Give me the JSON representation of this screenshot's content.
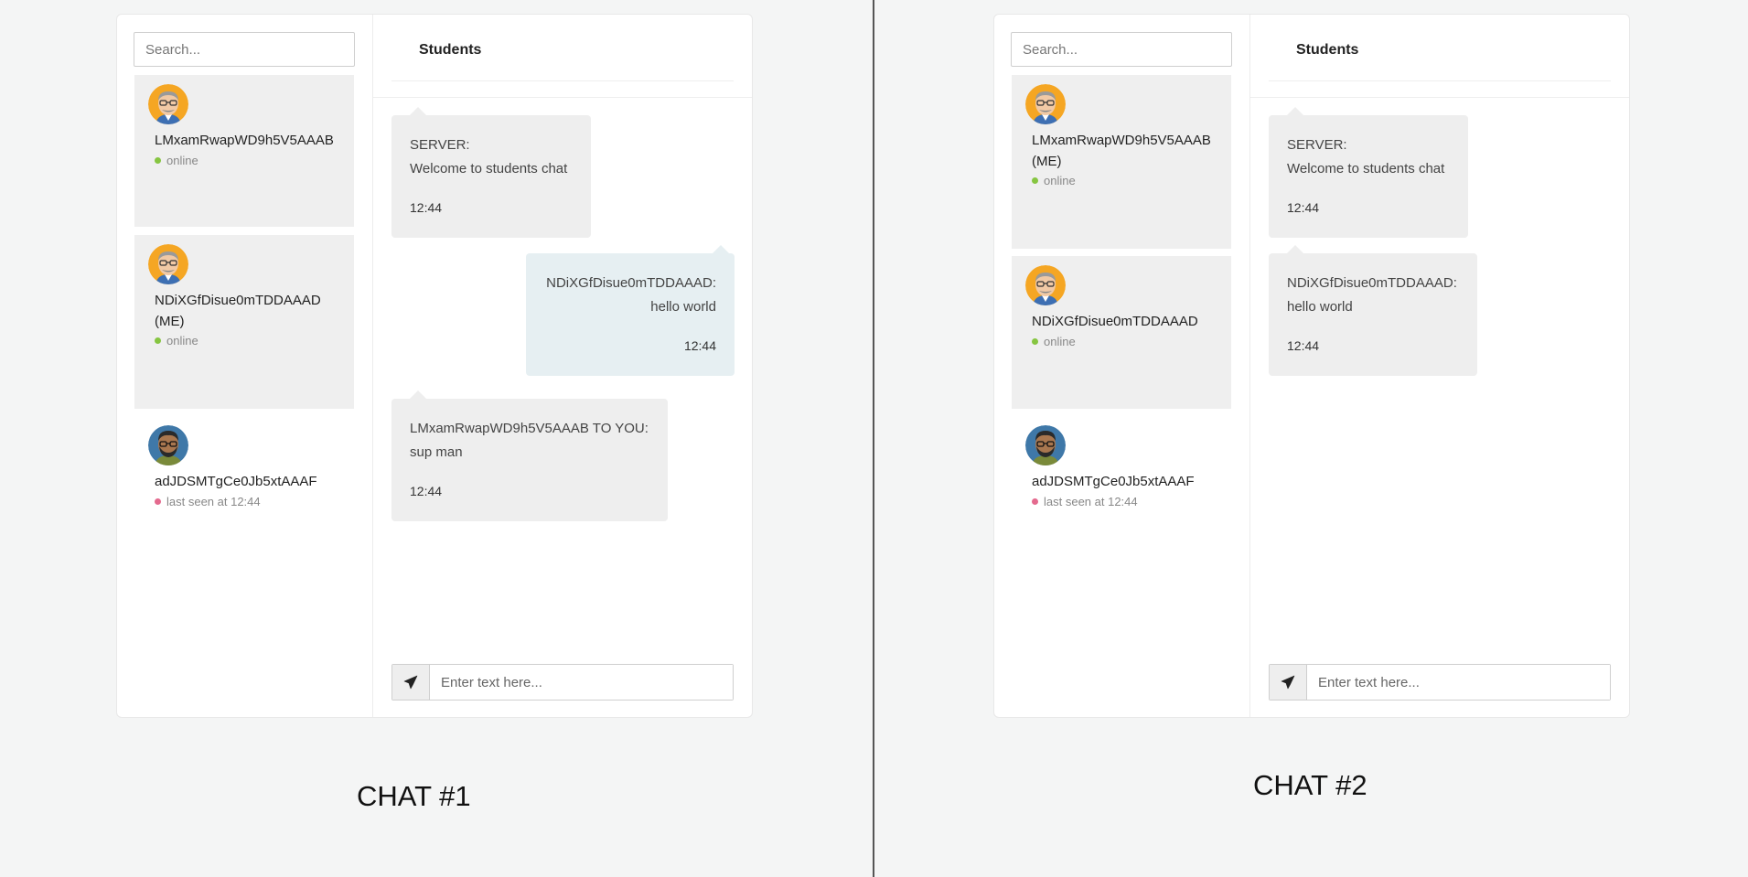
{
  "chat1": {
    "search_placeholder": "Search...",
    "title": "Students",
    "contacts": [
      {
        "name": "LMxamRwapWD9h5V5AAAB",
        "status": "online"
      },
      {
        "name": "NDiXGfDisue0mTDDAAAD (ME)",
        "status": "online"
      },
      {
        "name": "adJDSMTgCe0Jb5xtAAAF",
        "status": "last seen at 12:44"
      }
    ],
    "messages": [
      {
        "sender": "SERVER:",
        "text": "Welcome to students chat",
        "time": "12:44"
      },
      {
        "sender": "NDiXGfDisue0mTDDAAAD:",
        "text": "hello world",
        "time": "12:44"
      },
      {
        "sender": "LMxamRwapWD9h5V5AAAB TO YOU:",
        "text": "sup man",
        "time": "12:44"
      }
    ],
    "input_placeholder": "Enter text here...",
    "caption": "CHAT #1"
  },
  "chat2": {
    "search_placeholder": "Search...",
    "title": "Students",
    "contacts": [
      {
        "name": "LMxamRwapWD9h5V5AAAB (ME)",
        "status": "online"
      },
      {
        "name": "NDiXGfDisue0mTDDAAAD",
        "status": "online"
      },
      {
        "name": "adJDSMTgCe0Jb5xtAAAF",
        "status": "last seen at 12:44"
      }
    ],
    "messages": [
      {
        "sender": "SERVER:",
        "text": "Welcome to students chat",
        "time": "12:44"
      },
      {
        "sender": "NDiXGfDisue0mTDDAAAD:",
        "text": "hello world",
        "time": "12:44"
      }
    ],
    "input_placeholder": "Enter text here...",
    "caption": "CHAT #2"
  },
  "colors": {
    "online": "#86c541",
    "offline": "#e46a8e",
    "bubble_in": "#eeeeee",
    "bubble_out": "#e6eff2",
    "background": "#f4f5f5"
  },
  "icons": {
    "send": "paper-plane-icon",
    "avatar_1": "bald-man-glasses-avatar",
    "avatar_2": "bearded-man-glasses-avatar"
  }
}
